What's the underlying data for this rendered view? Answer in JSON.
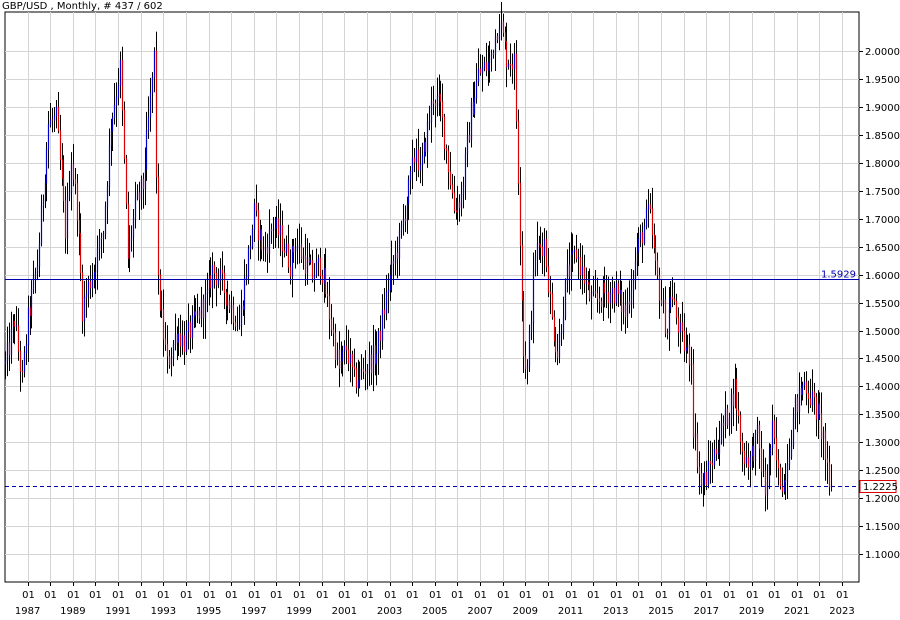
{
  "chart_data": {
    "type": "ohlc",
    "title": "GBP/USD , Monthly, # 437 / 602",
    "ylim": [
      1.05,
      2.07
    ],
    "y_ticks": [
      "2.0000",
      "1.9500",
      "1.9000",
      "1.8500",
      "1.8000",
      "1.7500",
      "1.7000",
      "1.6500",
      "1.6000",
      "1.5500",
      "1.5000",
      "1.4500",
      "1.4000",
      "1.3500",
      "1.3000",
      "1.2500",
      "1.2000",
      "1.1500",
      "1.1000"
    ],
    "x_range": [
      "1986-01",
      "2023-10"
    ],
    "x_year_labels": [
      "1987",
      "1989",
      "1991",
      "1993",
      "1995",
      "1997",
      "1999",
      "2001",
      "2003",
      "2005",
      "2007",
      "2009",
      "2011",
      "2013",
      "2015",
      "2017",
      "2019",
      "2021",
      "2023"
    ],
    "x_month_label": "01",
    "grid": true,
    "colors": {
      "up": "#0000cc",
      "down": "#dd0000",
      "wick": "#000000",
      "grid": "#d4d4d4",
      "ref_line": "#0000aa",
      "price_box": "#dd0000"
    },
    "reference_line": {
      "value": 1.5929,
      "label": "1.5929",
      "style": "solid"
    },
    "last_price": {
      "value": 1.2225,
      "label": "1.2225",
      "style": "dashed"
    },
    "series": [
      {
        "anchors": [
          [
            "1986-01",
            1.44
          ],
          [
            "1986-06",
            1.52
          ],
          [
            "1986-10",
            1.41
          ],
          [
            "1987-01",
            1.52
          ],
          [
            "1987-06",
            1.62
          ],
          [
            "1987-12",
            1.87
          ],
          [
            "1988-04",
            1.88
          ],
          [
            "1988-09",
            1.68
          ],
          [
            "1988-12",
            1.81
          ],
          [
            "1989-03",
            1.72
          ],
          [
            "1989-06",
            1.54
          ],
          [
            "1989-09",
            1.58
          ],
          [
            "1989-12",
            1.61
          ],
          [
            "1990-05",
            1.68
          ],
          [
            "1990-09",
            1.87
          ],
          [
            "1990-12",
            1.93
          ],
          [
            "1991-02",
            1.97
          ],
          [
            "1991-06",
            1.63
          ],
          [
            "1991-10",
            1.72
          ],
          [
            "1992-02",
            1.76
          ],
          [
            "1992-08",
            1.99
          ],
          [
            "1992-10",
            1.58
          ],
          [
            "1992-12",
            1.52
          ],
          [
            "1993-03",
            1.44
          ],
          [
            "1993-08",
            1.5
          ],
          [
            "1993-12",
            1.48
          ],
          [
            "1994-06",
            1.52
          ],
          [
            "1994-12",
            1.56
          ],
          [
            "1995-03",
            1.61
          ],
          [
            "1995-07",
            1.59
          ],
          [
            "1995-12",
            1.55
          ],
          [
            "1996-05",
            1.51
          ],
          [
            "1996-11",
            1.66
          ],
          [
            "1997-01",
            1.71
          ],
          [
            "1997-06",
            1.64
          ],
          [
            "1997-11",
            1.69
          ],
          [
            "1998-03",
            1.67
          ],
          [
            "1998-08",
            1.62
          ],
          [
            "1998-11",
            1.66
          ],
          [
            "1999-03",
            1.63
          ],
          [
            "1999-08",
            1.6
          ],
          [
            "1999-12",
            1.62
          ],
          [
            "2000-02",
            1.59
          ],
          [
            "2000-08",
            1.47
          ],
          [
            "2000-10",
            1.43
          ],
          [
            "2001-02",
            1.47
          ],
          [
            "2001-06",
            1.41
          ],
          [
            "2001-11",
            1.43
          ],
          [
            "2002-06",
            1.46
          ],
          [
            "2002-12",
            1.58
          ],
          [
            "2003-06",
            1.66
          ],
          [
            "2003-12",
            1.77
          ],
          [
            "2004-03",
            1.83
          ],
          [
            "2004-05",
            1.78
          ],
          [
            "2004-12",
            1.92
          ],
          [
            "2005-04",
            1.9
          ],
          [
            "2005-11",
            1.72
          ],
          [
            "2006-03",
            1.74
          ],
          [
            "2006-08",
            1.89
          ],
          [
            "2006-12",
            1.96
          ],
          [
            "2007-06",
            1.98
          ],
          [
            "2007-11",
            2.06
          ],
          [
            "2008-03",
            1.99
          ],
          [
            "2008-07",
            1.98
          ],
          [
            "2008-09",
            1.78
          ],
          [
            "2008-12",
            1.46
          ],
          [
            "2009-02",
            1.43
          ],
          [
            "2009-06",
            1.64
          ],
          [
            "2009-11",
            1.66
          ],
          [
            "2010-03",
            1.52
          ],
          [
            "2010-06",
            1.46
          ],
          [
            "2010-11",
            1.6
          ],
          [
            "2011-04",
            1.64
          ],
          [
            "2011-10",
            1.57
          ],
          [
            "2012-01",
            1.55
          ],
          [
            "2012-08",
            1.57
          ],
          [
            "2013-01",
            1.57
          ],
          [
            "2013-06",
            1.53
          ],
          [
            "2013-12",
            1.64
          ],
          [
            "2014-06",
            1.71
          ],
          [
            "2014-07",
            1.7
          ],
          [
            "2014-10",
            1.61
          ],
          [
            "2015-04",
            1.5
          ],
          [
            "2015-06",
            1.57
          ],
          [
            "2015-12",
            1.48
          ],
          [
            "2016-05",
            1.45
          ],
          [
            "2016-06",
            1.33
          ],
          [
            "2016-10",
            1.22
          ],
          [
            "2017-01",
            1.24
          ],
          [
            "2017-06",
            1.29
          ],
          [
            "2017-12",
            1.35
          ],
          [
            "2018-04",
            1.4
          ],
          [
            "2018-08",
            1.28
          ],
          [
            "2018-12",
            1.27
          ],
          [
            "2019-04",
            1.31
          ],
          [
            "2019-08",
            1.21
          ],
          [
            "2019-12",
            1.32
          ],
          [
            "2020-03",
            1.24
          ],
          [
            "2020-06",
            1.23
          ],
          [
            "2020-12",
            1.36
          ],
          [
            "2021-05",
            1.41
          ],
          [
            "2021-12",
            1.35
          ],
          [
            "2022-03",
            1.31
          ],
          [
            "2022-06",
            1.21
          ],
          [
            "2022-07",
            1.22
          ]
        ]
      }
    ]
  }
}
